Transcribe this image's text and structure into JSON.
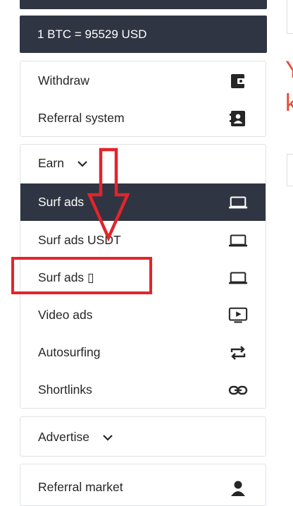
{
  "rate": {
    "text": "1 BTC = 95529 USD"
  },
  "account_menu": {
    "items": [
      {
        "label": "Withdraw",
        "icon": "wallet-icon"
      },
      {
        "label": "Referral system",
        "icon": "id-badge-icon"
      }
    ]
  },
  "earn_menu": {
    "header": "Earn",
    "items": [
      {
        "label": "Surf ads",
        "icon": "laptop-icon",
        "active": true
      },
      {
        "label": "Surf ads USDT",
        "icon": "laptop-icon"
      },
      {
        "label": "Surf ads ▯",
        "icon": "laptop-icon"
      },
      {
        "label": "Video ads",
        "icon": "tv-play-icon"
      },
      {
        "label": "Autosurfing",
        "icon": "repeat-icon"
      },
      {
        "label": "Shortlinks",
        "icon": "link-icon"
      }
    ]
  },
  "advertise_menu": {
    "header": "Advertise"
  },
  "market_menu": {
    "first_item": "Referral market",
    "icon": "user-icon"
  },
  "right_panel": {
    "letters": [
      "Y",
      "k"
    ]
  },
  "colors": {
    "dark": "#2f3542",
    "annotation_red": "#e3242b",
    "accent_red": "#e74c3c"
  }
}
